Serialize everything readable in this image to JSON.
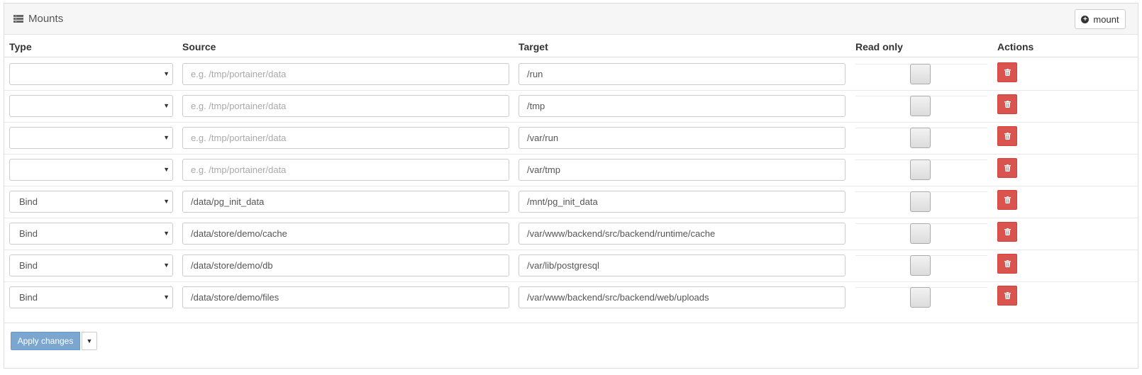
{
  "panel": {
    "title": "Mounts",
    "mount_button_label": "mount"
  },
  "columns": {
    "type": "Type",
    "source": "Source",
    "target": "Target",
    "read_only": "Read only",
    "actions": "Actions"
  },
  "rows": [
    {
      "type": "",
      "source": "",
      "source_placeholder": "e.g. /tmp/portainer/data",
      "target": "/run",
      "read_only": false
    },
    {
      "type": "",
      "source": "",
      "source_placeholder": "e.g. /tmp/portainer/data",
      "target": "/tmp",
      "read_only": false
    },
    {
      "type": "",
      "source": "",
      "source_placeholder": "e.g. /tmp/portainer/data",
      "target": "/var/run",
      "read_only": false
    },
    {
      "type": "",
      "source": "",
      "source_placeholder": "e.g. /tmp/portainer/data",
      "target": "/var/tmp",
      "read_only": false
    },
    {
      "type": "Bind",
      "source": "/data/pg_init_data",
      "source_placeholder": "e.g. /tmp/portainer/data",
      "target": "/mnt/pg_init_data",
      "read_only": false
    },
    {
      "type": "Bind",
      "source": "/data/store/demo/cache",
      "source_placeholder": "e.g. /tmp/portainer/data",
      "target": "/var/www/backend/src/backend/runtime/cache",
      "read_only": false
    },
    {
      "type": "Bind",
      "source": "/data/store/demo/db",
      "source_placeholder": "e.g. /tmp/portainer/data",
      "target": "/var/lib/postgresql",
      "read_only": false
    },
    {
      "type": "Bind",
      "source": "/data/store/demo/files",
      "source_placeholder": "e.g. /tmp/portainer/data",
      "target": "/var/www/backend/src/backend/web/uploads",
      "read_only": false
    }
  ],
  "footer": {
    "apply_label": "Apply changes"
  },
  "colors": {
    "danger": "#d9534f",
    "primary_disabled": "#7aa6d0"
  },
  "icons": {
    "header": "list-icon",
    "mount": "plus-circle-icon",
    "delete": "trash-icon",
    "select": "caret-down-icon"
  }
}
